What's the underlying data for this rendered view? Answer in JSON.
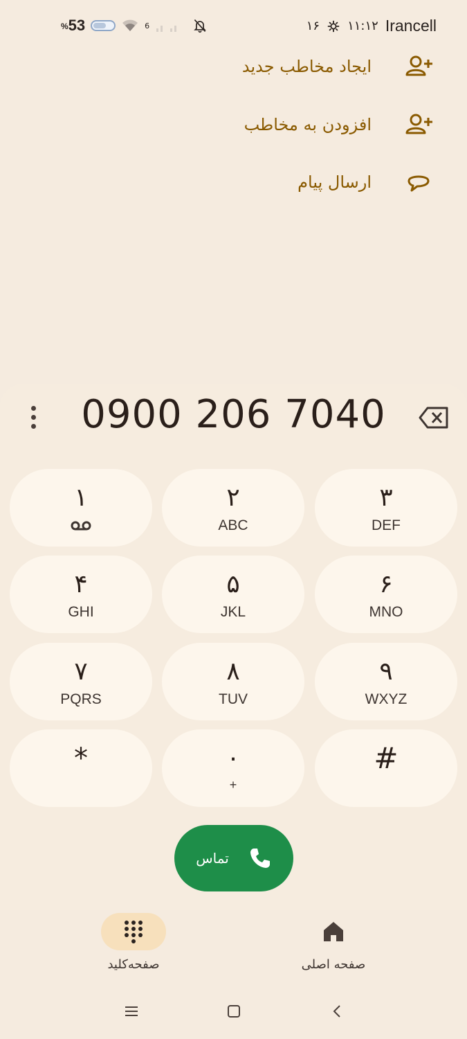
{
  "status_bar": {
    "carrier": "Irancell",
    "time": "۱۱:۱۲",
    "date_small": "۱۶",
    "battery_percent": "53",
    "battery_percent_sign": "%",
    "signal_label": "6",
    "icons": [
      "wifi-icon",
      "signal-icon",
      "bell-off-icon",
      "settings-icon"
    ]
  },
  "actions": [
    {
      "label": "ایجاد مخاطب جدید",
      "icon": "person-add-icon"
    },
    {
      "label": "افزودن به مخاطب",
      "icon": "person-add-icon"
    },
    {
      "label": "ارسال پیام",
      "icon": "message-icon"
    }
  ],
  "dialer": {
    "number": "0900 206 7040",
    "keys": [
      {
        "digit": "۱",
        "sub": ""
      },
      {
        "digit": "۲",
        "sub": "ABC"
      },
      {
        "digit": "۳",
        "sub": "DEF"
      },
      {
        "digit": "۴",
        "sub": "GHI"
      },
      {
        "digit": "۵",
        "sub": "JKL"
      },
      {
        "digit": "۶",
        "sub": "MNO"
      },
      {
        "digit": "۷",
        "sub": "PQRS"
      },
      {
        "digit": "۸",
        "sub": "TUV"
      },
      {
        "digit": "۹",
        "sub": "WXYZ"
      },
      {
        "digit": "*",
        "sub": ""
      },
      {
        "digit": "۰",
        "sub": "+"
      },
      {
        "digit": "#",
        "sub": ""
      }
    ],
    "call_label": "تماس"
  },
  "bottom_nav": {
    "keypad_label": "صفحه‌کلید",
    "home_label": "صفحه اصلی"
  },
  "colors": {
    "background": "#f5ebdf",
    "accent": "#8a5a00",
    "call_green": "#1e8e49",
    "key_bg": "#fdf6ec",
    "nav_active": "#f7e0bc"
  }
}
